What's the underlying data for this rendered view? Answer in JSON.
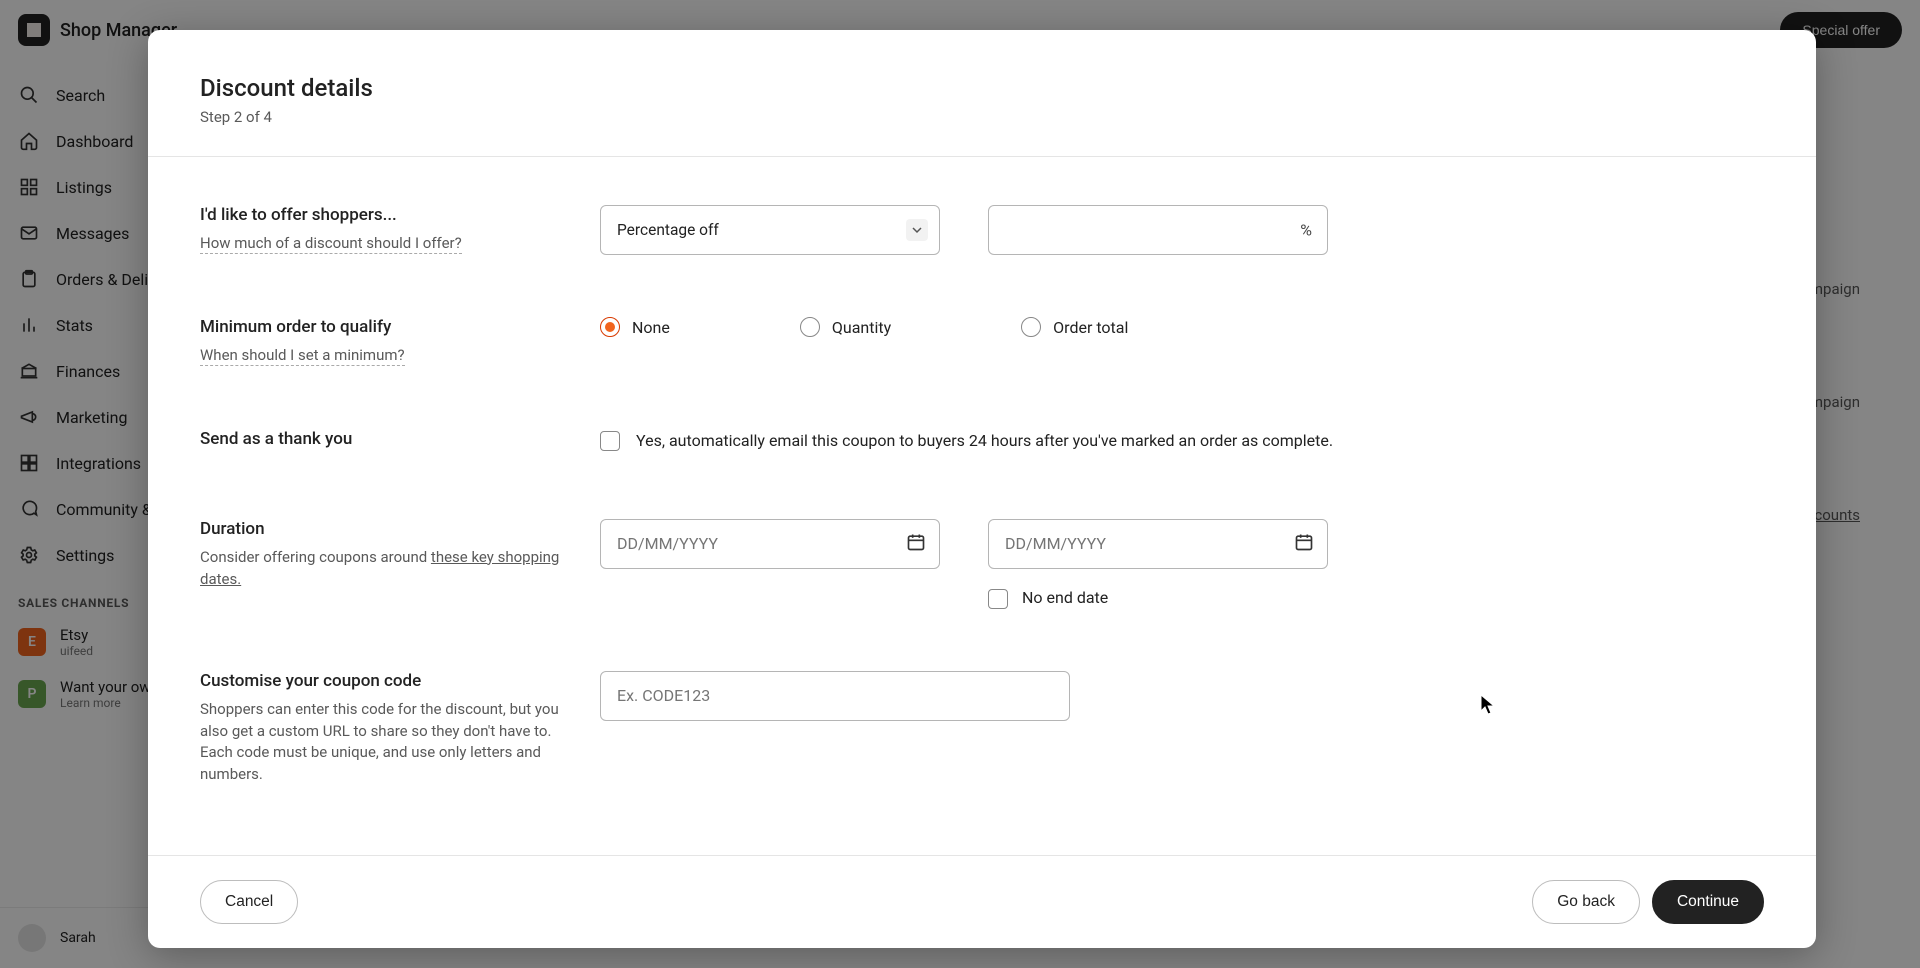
{
  "brand": {
    "name": "Shop Manager"
  },
  "topbar": {
    "cta_button": "Special offer"
  },
  "sidebar": {
    "items": [
      {
        "label": "Search"
      },
      {
        "label": "Dashboard"
      },
      {
        "label": "Listings"
      },
      {
        "label": "Messages"
      },
      {
        "label": "Orders & Delivery"
      },
      {
        "label": "Stats"
      },
      {
        "label": "Finances"
      },
      {
        "label": "Marketing"
      },
      {
        "label": "Integrations"
      },
      {
        "label": "Community & Help"
      },
      {
        "label": "Settings"
      }
    ],
    "section_header": "SALES CHANNELS",
    "channels": [
      {
        "badge": "E",
        "name": "Etsy",
        "handle": "uifeed"
      },
      {
        "badge": "P",
        "name": "Want your own website?",
        "handle": "Learn more"
      }
    ],
    "user": {
      "name": "Sarah"
    }
  },
  "content": {
    "right_actions": [
      "Campaign",
      "Campaign"
    ],
    "right_link": "Discounts"
  },
  "modal": {
    "title": "Discount details",
    "step": "Step 2 of 4",
    "offer": {
      "title": "I'd like to offer shoppers...",
      "hint": "How much of a discount should I offer?",
      "select_value": "Percentage off",
      "pct_suffix": "%"
    },
    "minimum": {
      "title": "Minimum order to qualify",
      "hint": "When should I set a minimum?",
      "options": {
        "none": "None",
        "quantity": "Quantity",
        "order_total": "Order total"
      },
      "selected": "none"
    },
    "thankyou": {
      "title": "Send as a thank you",
      "checkbox_label": "Yes, automatically email this coupon to buyers 24 hours after you've marked an order as complete."
    },
    "duration": {
      "title": "Duration",
      "hint_prefix": "Consider offering coupons around ",
      "hint_link": "these key shopping dates.",
      "start_placeholder": "DD/MM/YYYY",
      "end_placeholder": "DD/MM/YYYY",
      "no_end": "No end date"
    },
    "code": {
      "title": "Customise your coupon code",
      "hint": "Shoppers can enter this code for the discount, but you also get a custom URL to share so they don't have to. Each code must be unique, and use only letters and numbers.",
      "placeholder": "Ex. CODE123"
    },
    "footer": {
      "cancel": "Cancel",
      "back": "Go back",
      "continue": "Continue"
    }
  }
}
